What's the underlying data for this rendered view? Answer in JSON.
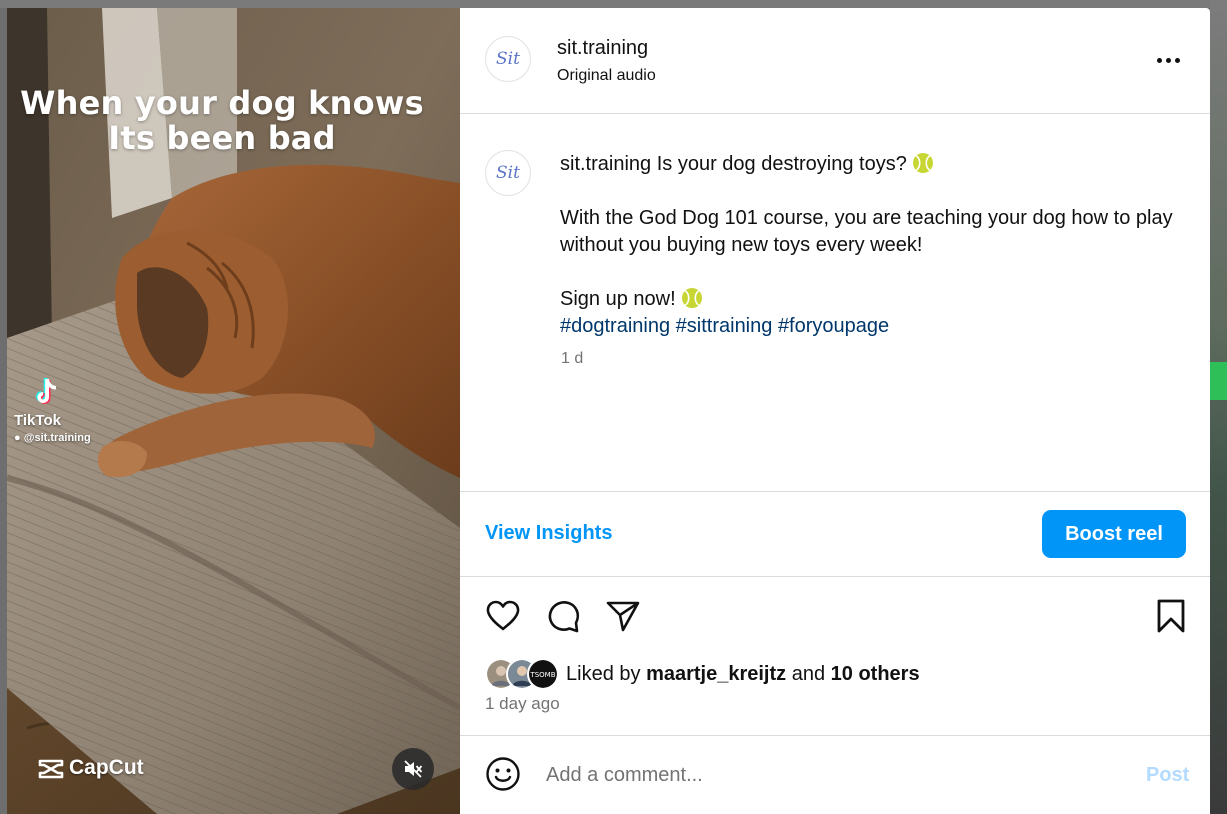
{
  "video": {
    "overlay_caption_line1": "When your dog knows",
    "overlay_caption_line2": "Its been bad",
    "tiktok_label": "TikTok",
    "tiktok_handle": "@sit.training",
    "capcut_label": "CapCut",
    "mute_icon": "speaker-muted-icon"
  },
  "header": {
    "avatar_text": "Sit",
    "username": "sit.training",
    "audio": "Original audio"
  },
  "caption": {
    "username": "sit.training",
    "line1": "Is your dog destroying toys?",
    "paragraph2": "With the God Dog 101 course, you are teaching your dog how to play without you buying new toys every week!",
    "line3": "Sign up now!",
    "hashtags": [
      "#dogtraining",
      "#sittraining",
      "#foryoupage"
    ],
    "age": "1 d"
  },
  "actions": {
    "insights": "View Insights",
    "boost": "Boost reel"
  },
  "likes": {
    "prefix": "Liked by",
    "first_liker": "maartje_kreijtz",
    "joiner": "and",
    "others": "10 others",
    "third_avatar_text": "TSOMB"
  },
  "post_age": "1 day ago",
  "comment": {
    "placeholder": "Add a comment...",
    "post_label": "Post"
  },
  "colors": {
    "accent": "#0095f6",
    "hashtag": "#00376b",
    "muted": "#737373",
    "post_disabled": "#b3dbff"
  }
}
